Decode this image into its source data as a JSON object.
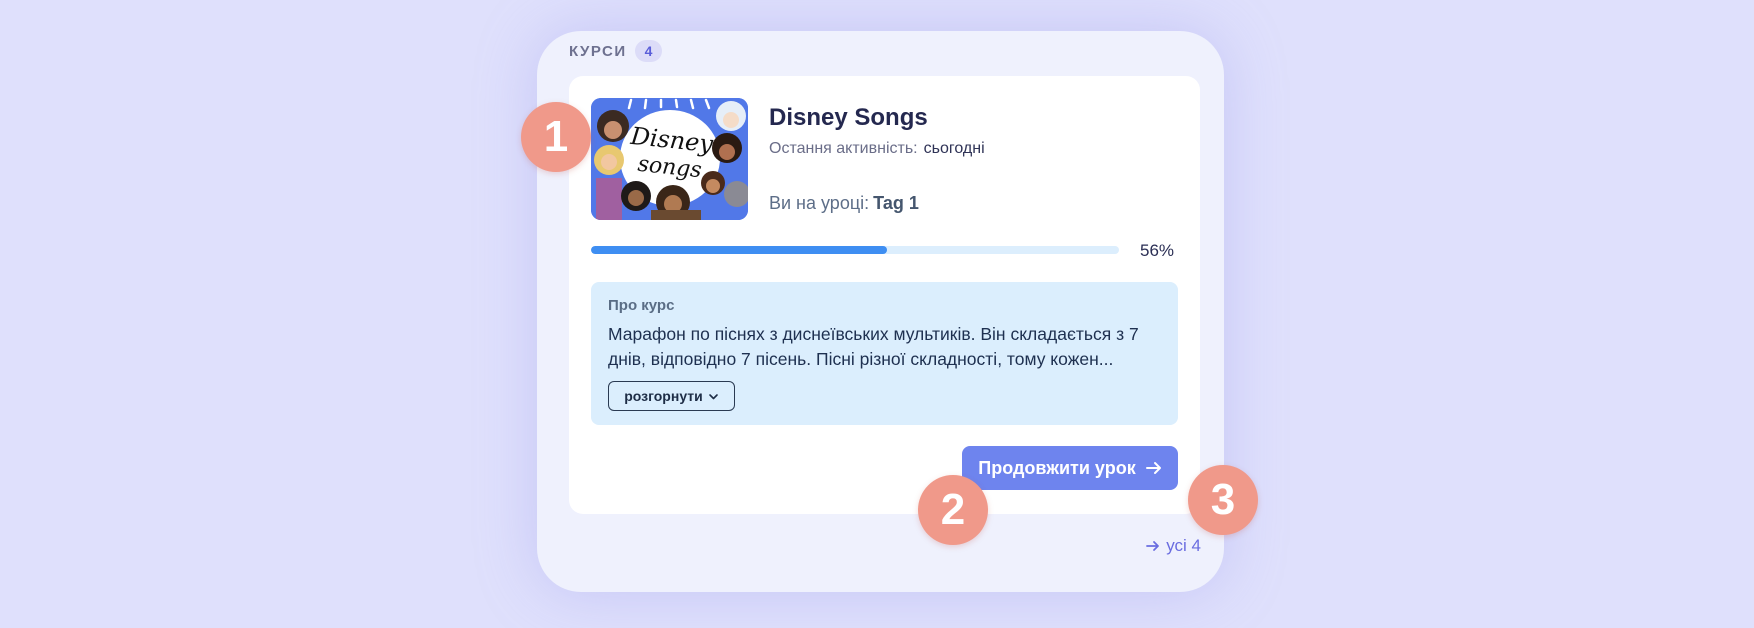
{
  "panel": {
    "title": "КУРСИ",
    "count": "4"
  },
  "course": {
    "title": "Disney Songs",
    "activity_label": "Остання активність:",
    "activity_value": "сьогодні",
    "lesson_label": "Ви на уроці:",
    "lesson_value": "Tag 1",
    "progress_percent": 56,
    "progress_text": "56%",
    "thumbnail_text": "Disney songs"
  },
  "about": {
    "label": "Про курс",
    "text": "Марафон по піснях з диснеївських мультиків. Він складається з 7 днів, відповідно 7 пісень. Пісні різної складності, тому кожен...",
    "expand_label": "розгорнути"
  },
  "actions": {
    "continue_label": "Продовжити урок",
    "all_label": "усі 4"
  },
  "markers": [
    "1",
    "2",
    "3"
  ],
  "colors": {
    "background": "#dfe0fc",
    "accent": "#6e84ee",
    "progress": "#3e8ef2",
    "marker": "#f0998a"
  },
  "icons": {
    "arrow": "arrow-right-icon",
    "chevron": "chevron-down-icon"
  }
}
